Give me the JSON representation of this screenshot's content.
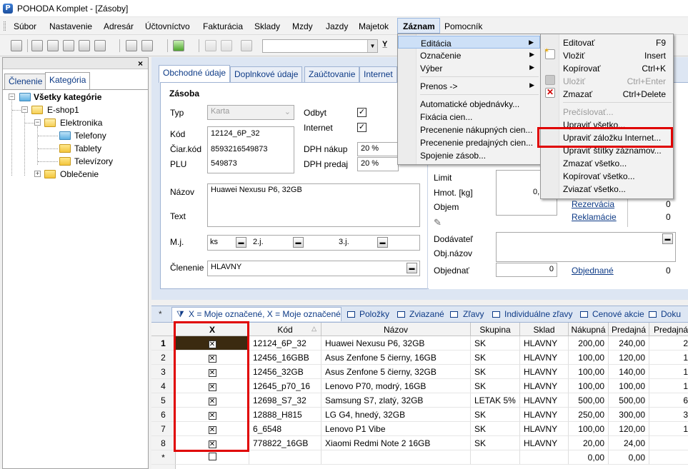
{
  "window": {
    "title": "POHODA Komplet - [Zásoby]",
    "app_icon": "P"
  },
  "menubar": [
    "Súbor",
    "Nastavenie",
    "Adresár",
    "Účtovníctvo",
    "Fakturácia",
    "Sklady",
    "Mzdy",
    "Jazdy",
    "Majetok",
    "Záznam",
    "Pomocník"
  ],
  "left_panel": {
    "close": "×",
    "tabs": [
      "Členenie",
      "Kategória"
    ],
    "tree": {
      "root": "Všetky kategórie",
      "shop": "E-shop1",
      "electronics": "Elektronika",
      "phones": "Telefony",
      "tablets": "Tablety",
      "tvs": "Televízory",
      "clothes": "Oblečenie"
    }
  },
  "form_tabs": [
    "Obchodné údaje",
    "Doplnkové údaje",
    "Zaúčtovanie",
    "Internet"
  ],
  "form": {
    "section": "Zásoba",
    "typ_label": "Typ",
    "typ_value": "Karta",
    "kod_label": "Kód",
    "kod_value": "12124_6P_32",
    "ciarkod_label": "Čiar.kód",
    "ciarkod_value": "8593216549873",
    "plu_label": "PLU",
    "plu_value": "549873",
    "odbyt_label": "Odbyt",
    "internet_label": "Internet",
    "dph_nakup_label": "DPH nákup",
    "dph_nakup_value": "20 %",
    "dph_predaj_label": "DPH predaj",
    "dph_predaj_value": "20 %",
    "nazov_label": "Názov",
    "nazov_value": "Huawei Nexusu P6, 32GB",
    "text_label": "Text",
    "mj_label": "M.j.",
    "mj_value": "ks",
    "mj2_label": "2.j.",
    "mj3_label": "3.j.",
    "clenenie_label": "Členenie",
    "clenenie_value": "HLAVNY",
    "limit_label": "Limit",
    "hmot_label": "Hmot. [kg]",
    "hmot_value": "0,",
    "objem_label": "Objem",
    "rezervacia_label": "Rezervácia",
    "rezervacia_value": "0",
    "reklamacie_label": "Reklamácie",
    "reklamacie_value": "0",
    "dodavatel_label": "Dodávateľ",
    "objnazov_label": "Obj.názov",
    "objednat_label": "Objednať",
    "objednat_value": "0",
    "objednane_label": "Objednané",
    "objednane_value": "0",
    "top_right_zero": "0"
  },
  "grid_tabs": [
    "X = Moje označené, X = Moje označené",
    "Položky",
    "Zviazané",
    "Zľavy",
    "Individuálne zľavy",
    "Cenové akcie",
    "Doku"
  ],
  "grid_tab_asterisk": "*",
  "grid": {
    "headers": [
      "X",
      "Kód",
      "Názov",
      "Skupina",
      "Sklad",
      "Nákupná",
      "Predajná",
      "Predajná"
    ],
    "rows": [
      {
        "n": "1",
        "kod": "12124_6P_32",
        "nazov": "Huawei Nexusu P6, 32GB",
        "skupina": "SK",
        "sklad": "HLAVNY",
        "nakupna": "200,00",
        "predajna": "240,00",
        "p2": "2"
      },
      {
        "n": "2",
        "kod": "12456_16GBB",
        "nazov": "Asus Zenfone 5 čierny, 16GB",
        "skupina": "SK",
        "sklad": "HLAVNY",
        "nakupna": "100,00",
        "predajna": "120,00",
        "p2": "1"
      },
      {
        "n": "3",
        "kod": "12456_32GB",
        "nazov": "Asus Zenfone 5 čierny, 32GB",
        "skupina": "SK",
        "sklad": "HLAVNY",
        "nakupna": "100,00",
        "predajna": "140,00",
        "p2": "1"
      },
      {
        "n": "4",
        "kod": "12645_p70_16",
        "nazov": "Lenovo P70, modrý, 16GB",
        "skupina": "SK",
        "sklad": "HLAVNY",
        "nakupna": "100,00",
        "predajna": "100,00",
        "p2": "1"
      },
      {
        "n": "5",
        "kod": "12698_S7_32",
        "nazov": "Samsung S7, zlatý, 32GB",
        "skupina": "LETAK 5%",
        "sklad": "HLAVNY",
        "nakupna": "500,00",
        "predajna": "500,00",
        "p2": "6"
      },
      {
        "n": "6",
        "kod": "12888_H815",
        "nazov": "LG G4, hnedý, 32GB",
        "skupina": "SK",
        "sklad": "HLAVNY",
        "nakupna": "250,00",
        "predajna": "300,00",
        "p2": "3"
      },
      {
        "n": "7",
        "kod": "6_6548",
        "nazov": "Lenovo P1 Vibe",
        "skupina": "SK",
        "sklad": "HLAVNY",
        "nakupna": "100,00",
        "predajna": "120,00",
        "p2": "1"
      },
      {
        "n": "8",
        "kod": "778822_16GB",
        "nazov": "Xiaomi Redmi Note 2 16GB",
        "skupina": "SK",
        "sklad": "HLAVNY",
        "nakupna": "20,00",
        "predajna": "24,00",
        "p2": ""
      }
    ],
    "new_row": {
      "n": "*",
      "nakupna": "0,00",
      "predajna": "0,00"
    }
  },
  "menu_zaznam": {
    "items": [
      {
        "label": "Editácia",
        "submenu": true,
        "highlighted": true
      },
      {
        "label": "Označenie",
        "submenu": true
      },
      {
        "label": "Výber",
        "submenu": true
      },
      {
        "sep": true
      },
      {
        "label": "Prenos ->",
        "submenu": true
      },
      {
        "sep": true
      },
      {
        "label": "Automatické objednávky..."
      },
      {
        "label": "Fixácia cien..."
      },
      {
        "label": "Precenenie nákupných cien..."
      },
      {
        "label": "Precenenie predajných cien..."
      },
      {
        "label": "Spojenie zásob..."
      }
    ]
  },
  "menu_editacia": {
    "items": [
      {
        "label": "Editovať",
        "shortcut": "F9"
      },
      {
        "label": "Vložiť",
        "shortcut": "Insert",
        "icon": "new-icon"
      },
      {
        "label": "Kopírovať",
        "shortcut": "Ctrl+K"
      },
      {
        "label": "Uložiť",
        "shortcut": "Ctrl+Enter",
        "disabled": true,
        "icon": "save-icon"
      },
      {
        "label": "Zmazať",
        "shortcut": "Ctrl+Delete",
        "icon": "delete-icon"
      },
      {
        "sep": true
      },
      {
        "label": "Prečíslovať...",
        "disabled": true
      },
      {
        "label": "Upraviť všetko..."
      },
      {
        "label": "Upraviť záložku Internet...",
        "boxed": true
      },
      {
        "label": "Upraviť štítky záznamov..."
      },
      {
        "label": "Zmazať všetko..."
      },
      {
        "label": "Kopírovať všetko..."
      },
      {
        "label": "Zviazať všetko..."
      }
    ]
  },
  "colors": {
    "highlight_red": "#e00000",
    "menu_highlight": "#cde0f7",
    "selected_row": "#3b2a10"
  }
}
